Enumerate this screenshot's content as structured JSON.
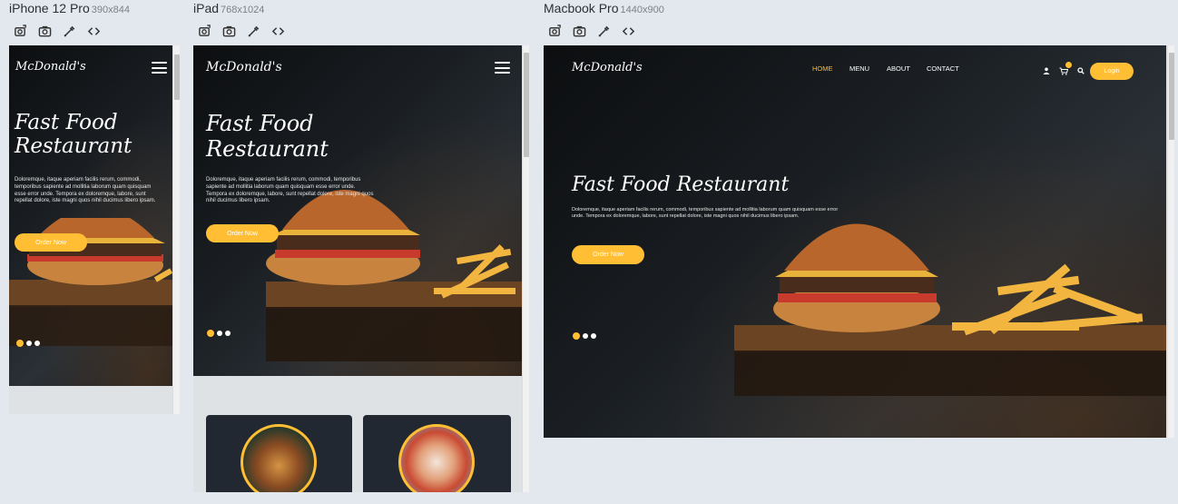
{
  "devices": [
    {
      "name": "iPhone 12 Pro",
      "dims": "390x844"
    },
    {
      "name": "iPad",
      "dims": "768x1024"
    },
    {
      "name": "Macbook Pro",
      "dims": "1440x900"
    }
  ],
  "toolbar_icons": [
    "rotate-screenshot-icon",
    "camera-icon",
    "eyedropper-icon",
    "code-icon"
  ],
  "site": {
    "logo": "McDonald's",
    "hero_title": "Fast Food Restaurant",
    "hero_title_line1": "Fast Food",
    "hero_title_line2": "Restaurant",
    "hero_text": "Doloremque, itaque aperiam facilis rerum, commodi, temporibus sapiente ad mollitia laborum quam quisquam esse error unde. Tempora ex doloremque, labore, sunt repellat dolore, iste magni quos nihil ducimus libero ipsam.",
    "order_button": "Order Now",
    "nav": [
      "HOME",
      "MENU",
      "ABOUT",
      "CONTACT"
    ],
    "login_button": "Login",
    "slide_count": 3,
    "active_slide": 1
  },
  "colors": {
    "accent": "#ffbe33",
    "dark": "#14171b",
    "card": "#222831",
    "page_bg": "#e3e8ef"
  }
}
